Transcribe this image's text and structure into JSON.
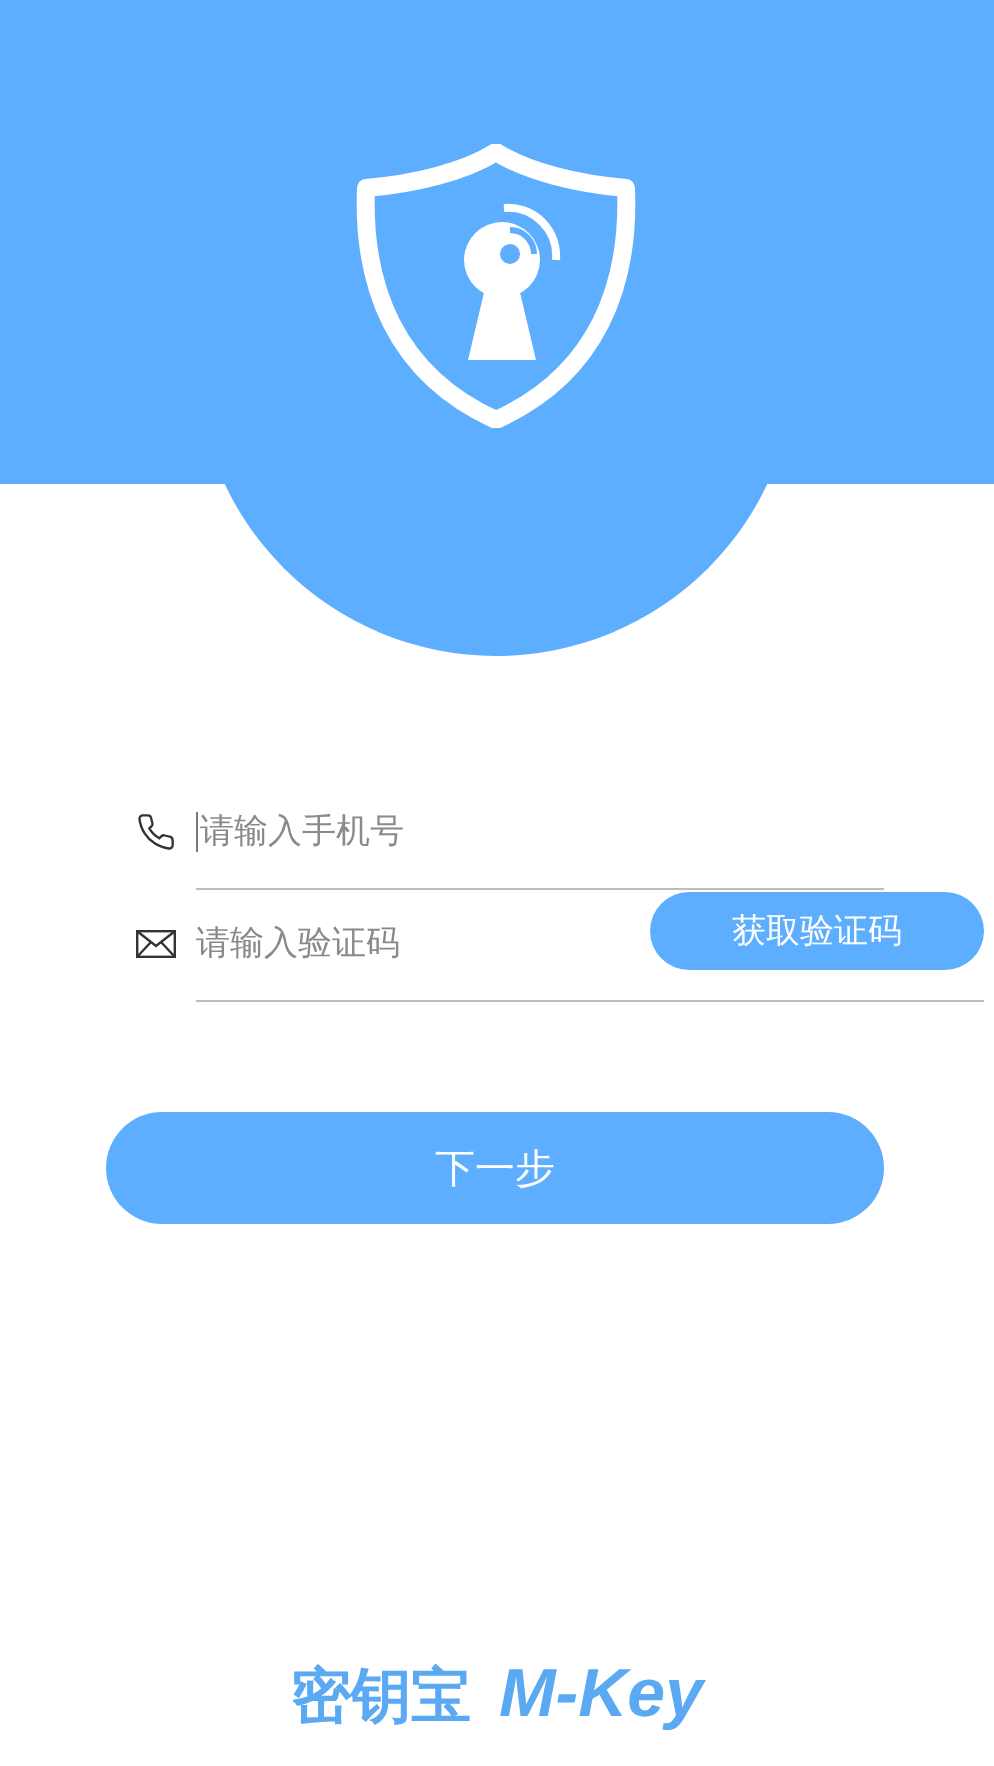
{
  "phone_field": {
    "placeholder": "请输入手机号",
    "focused": true
  },
  "code_field": {
    "placeholder": "请输入验证码"
  },
  "get_code_button": {
    "label": "获取验证码"
  },
  "next_button": {
    "label": "下一步"
  },
  "footer": {
    "brand_cn": "密钥宝",
    "brand_en": "M-Key"
  }
}
